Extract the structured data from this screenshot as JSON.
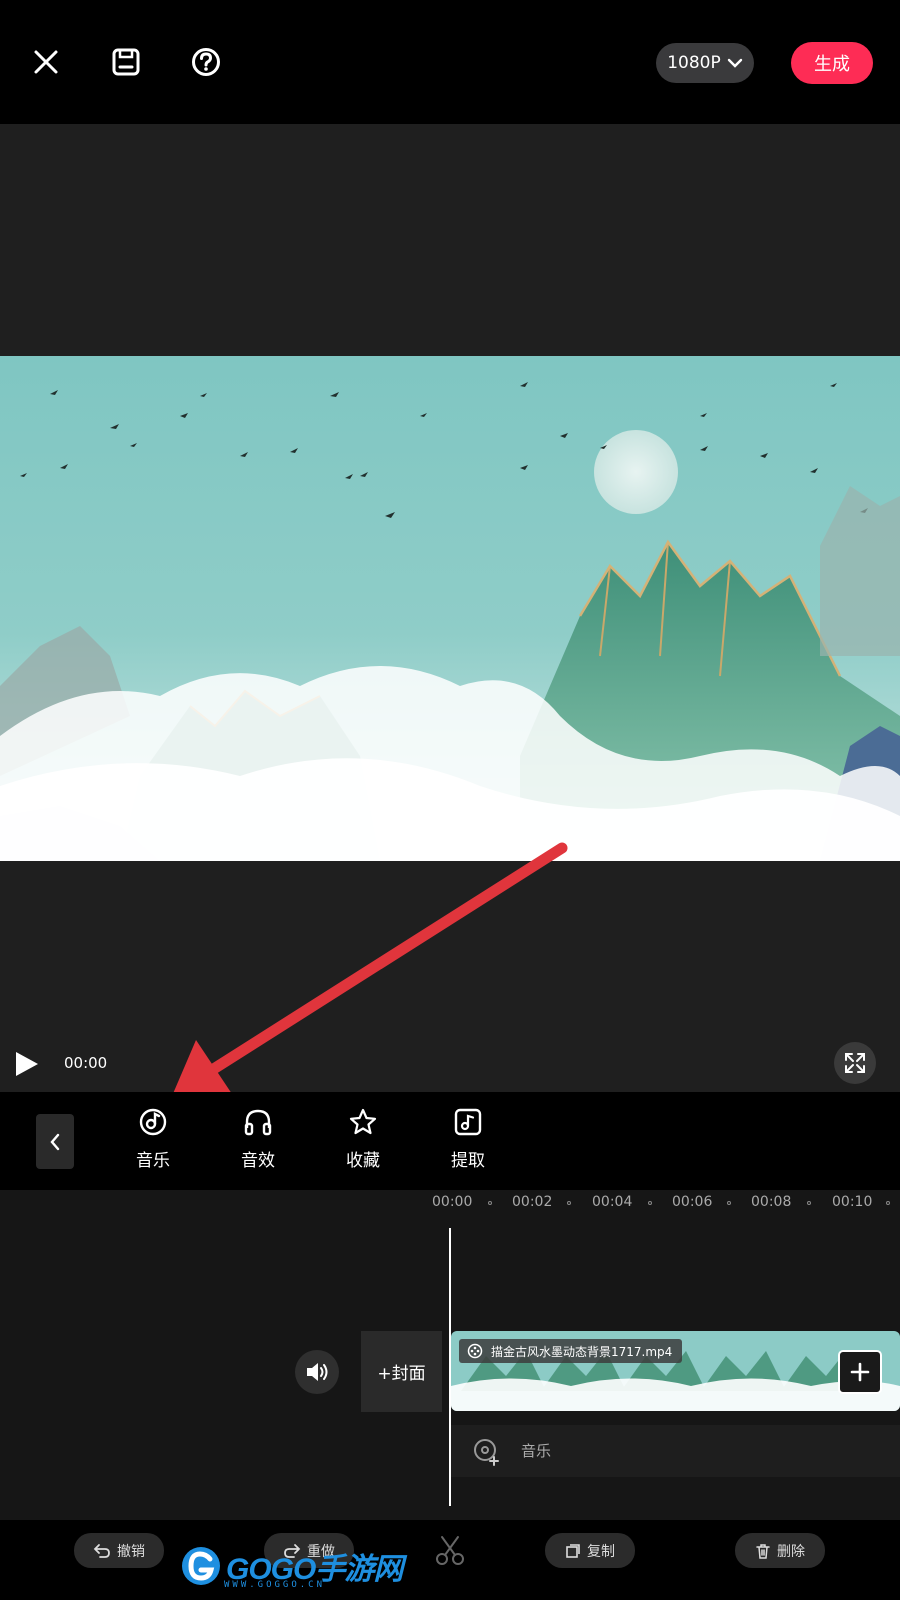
{
  "header": {
    "resolution": "1080P",
    "generate_label": "生成"
  },
  "player": {
    "time": "00:00"
  },
  "tools": [
    {
      "label": "音乐",
      "icon": "music-disc-icon"
    },
    {
      "label": "音效",
      "icon": "headphones-icon"
    },
    {
      "label": "收藏",
      "icon": "star-icon"
    },
    {
      "label": "提取",
      "icon": "music-note-icon"
    }
  ],
  "timeline": {
    "ruler": [
      "00:00",
      "00:02",
      "00:04",
      "00:06",
      "00:08",
      "00:10"
    ],
    "cover_label": "+封面",
    "clip_name": "描金古风水墨动态背景1717.mp4",
    "music_label": "音乐"
  },
  "actions": {
    "undo": "撤销",
    "redo": "重做",
    "copy": "复制",
    "delete": "删除"
  },
  "watermark": {
    "text": "GOGO手游网",
    "sub": "WWW.GOGGO.CN"
  },
  "colors": {
    "accent": "#fe2c55",
    "sky": "#86c9c4",
    "annotation_arrow": "#e0353c"
  }
}
